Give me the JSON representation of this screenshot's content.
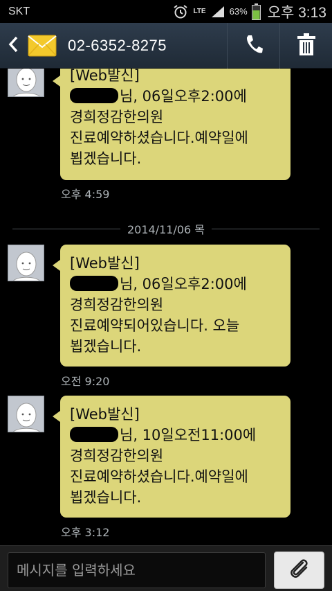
{
  "status_bar": {
    "carrier": "SKT",
    "network": "LTE",
    "battery_percent": "63%",
    "time": "오후 3:13",
    "icons": [
      "alarm-icon",
      "lte-icon",
      "signal-icon",
      "battery-icon"
    ]
  },
  "header": {
    "contact_number": "02-6352-8275",
    "icons": [
      "back-icon",
      "envelope-icon",
      "phone-icon",
      "trash-icon"
    ]
  },
  "messages": [
    {
      "lines": [
        "[Web발신]",
        "님, 06일오후2:00에",
        "경희정감한의원",
        "진료예약하셨습니다.예약일에",
        "뵙겠습니다."
      ],
      "time": "오후 4:59"
    },
    {
      "lines": [
        "[Web발신]",
        "님, 06일오후2:00에",
        "경희정감한의원",
        "진료예약되어있습니다. 오늘",
        "뵙겠습니다."
      ],
      "time": "오전 9:20"
    },
    {
      "lines": [
        "[Web발신]",
        "님, 10일오전11:00에",
        "경희정감한의원",
        "진료예약하셨습니다.예약일에",
        "뵙겠습니다."
      ],
      "time": "오후 3:12"
    }
  ],
  "date_divider": "2014/11/06 목",
  "composer": {
    "placeholder": "메시지를 입력하세요",
    "value": "",
    "attach_icon": "paperclip-icon"
  },
  "colors": {
    "bubble": "#dcd67a",
    "header": "#2e3c4c",
    "background": "#000000",
    "timestamp": "#aeb4b8"
  }
}
